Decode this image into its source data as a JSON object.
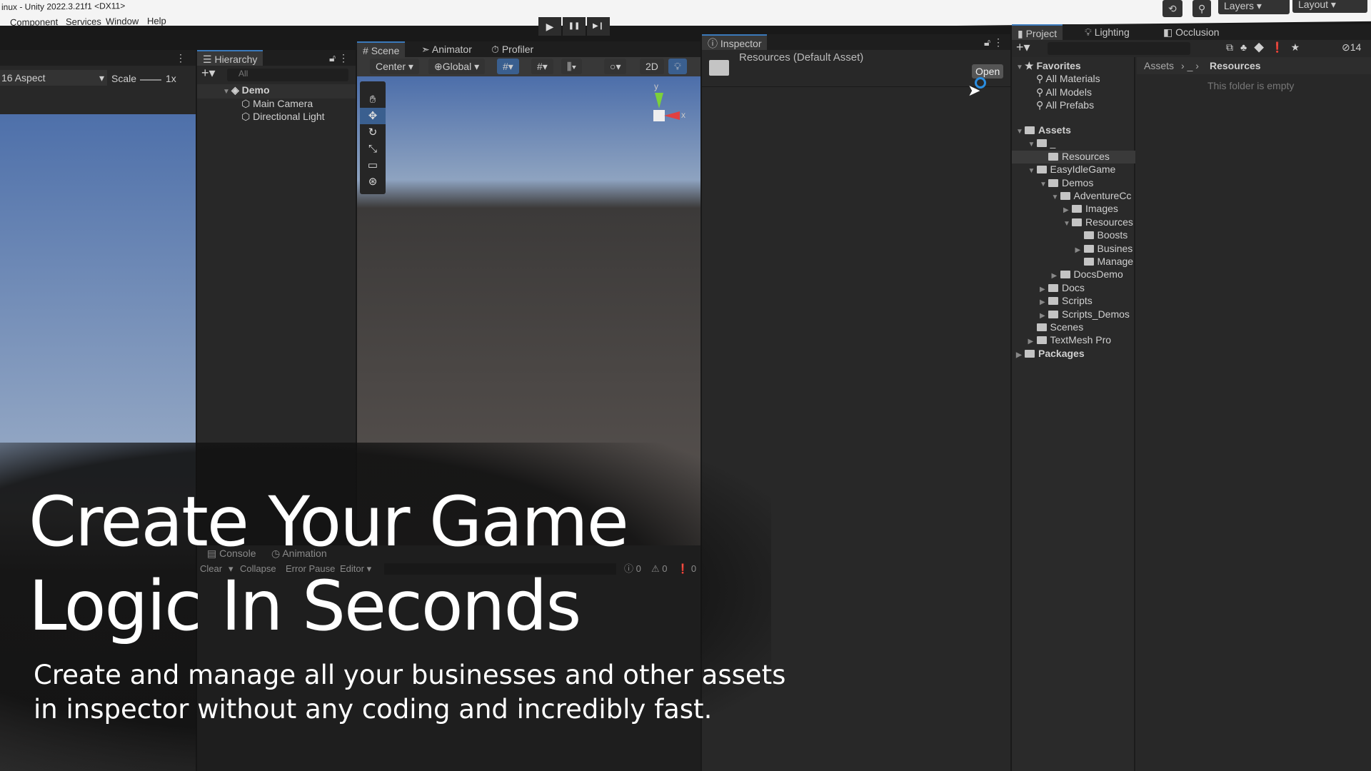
{
  "window": {
    "title": "inux - Unity 2022.3.21f1 <DX11>",
    "menu": [
      "Component",
      "Services",
      "Window",
      "Help"
    ]
  },
  "toolbar": {
    "layers": "Layers",
    "layout": "Layout",
    "play": "▶",
    "pause": "❚❚",
    "step": "▶❙"
  },
  "game": {
    "aspect": "16 Aspect",
    "scale_label": "Scale",
    "scale_value": "1x"
  },
  "hierarchy": {
    "tab": "Hierarchy",
    "search_placeholder": "All",
    "scene": "Demo",
    "items": [
      "Main Camera",
      "Directional Light"
    ]
  },
  "scene": {
    "tabs": [
      "Scene",
      "Animator",
      "Profiler"
    ],
    "pivot": "Center",
    "space": "Global",
    "mode_2d": "2D",
    "gizmo_y": "y",
    "gizmo_x": "x"
  },
  "console": {
    "tabs": [
      "Console",
      "Animation"
    ],
    "buttons": [
      "Clear",
      "Collapse",
      "Error Pause",
      "Editor"
    ],
    "counts": [
      "0",
      "0",
      "0"
    ]
  },
  "inspector": {
    "tab": "Inspector",
    "asset": "Resources (Default Asset)",
    "open": "Open"
  },
  "project": {
    "tabs": [
      "Project",
      "Lighting",
      "Occlusion"
    ],
    "hidden_count": "14",
    "favorites": {
      "label": "Favorites",
      "items": [
        "All Materials",
        "All Models",
        "All Prefabs"
      ]
    },
    "tree": [
      {
        "label": "Assets",
        "depth": 0,
        "arrow": "▼",
        "bold": true
      },
      {
        "label": "_",
        "depth": 1,
        "arrow": "▼"
      },
      {
        "label": "Resources",
        "depth": 2,
        "arrow": "",
        "selected": true
      },
      {
        "label": "EasyIdleGame",
        "depth": 1,
        "arrow": "▼"
      },
      {
        "label": "Demos",
        "depth": 2,
        "arrow": "▼"
      },
      {
        "label": "AdventureCc",
        "depth": 3,
        "arrow": "▼"
      },
      {
        "label": "Images",
        "depth": 4,
        "arrow": "▶"
      },
      {
        "label": "Resources",
        "depth": 4,
        "arrow": "▼"
      },
      {
        "label": "Boosts",
        "depth": 5,
        "arrow": ""
      },
      {
        "label": "Busines",
        "depth": 5,
        "arrow": "▶"
      },
      {
        "label": "Manage",
        "depth": 5,
        "arrow": ""
      },
      {
        "label": "DocsDemo",
        "depth": 3,
        "arrow": "▶"
      },
      {
        "label": "Docs",
        "depth": 2,
        "arrow": "▶"
      },
      {
        "label": "Scripts",
        "depth": 2,
        "arrow": "▶"
      },
      {
        "label": "Scripts_Demos",
        "depth": 2,
        "arrow": "▶"
      },
      {
        "label": "Scenes",
        "depth": 1,
        "arrow": ""
      },
      {
        "label": "TextMesh Pro",
        "depth": 1,
        "arrow": "▶"
      },
      {
        "label": "Packages",
        "depth": 0,
        "arrow": "▶",
        "bold": true
      }
    ],
    "breadcrumb": [
      "Assets",
      "_",
      "Resources"
    ],
    "empty": "This folder is empty"
  },
  "overlay": {
    "headline_1": "Create Your Game",
    "headline_2": "Logic In Seconds",
    "sub_1": "Create and manage all your businesses and other assets",
    "sub_2": "in inspector without any coding and incredibly fast."
  }
}
